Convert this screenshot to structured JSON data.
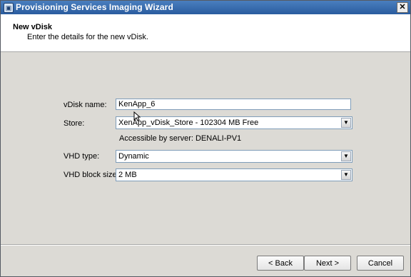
{
  "window": {
    "title": "Provisioning Services Imaging Wizard",
    "icon": "wizard-app-icon",
    "close_label": "✕"
  },
  "header": {
    "title": "New vDisk",
    "subtitle": "Enter the details for the new vDisk."
  },
  "form": {
    "vdisk_name": {
      "label": "vDisk name:",
      "value": "KenApp_6"
    },
    "store": {
      "label": "Store:",
      "value": "XenApp_vDisk_Store - 102304 MB Free",
      "note": "Accessible by server: DENALI-PV1"
    },
    "vhd_type": {
      "label": "VHD type:",
      "value": "Dynamic"
    },
    "vhd_block_size": {
      "label": "VHD block size:",
      "value": "2 MB"
    }
  },
  "buttons": {
    "back": "< Back",
    "next": "Next >",
    "cancel": "Cancel"
  }
}
